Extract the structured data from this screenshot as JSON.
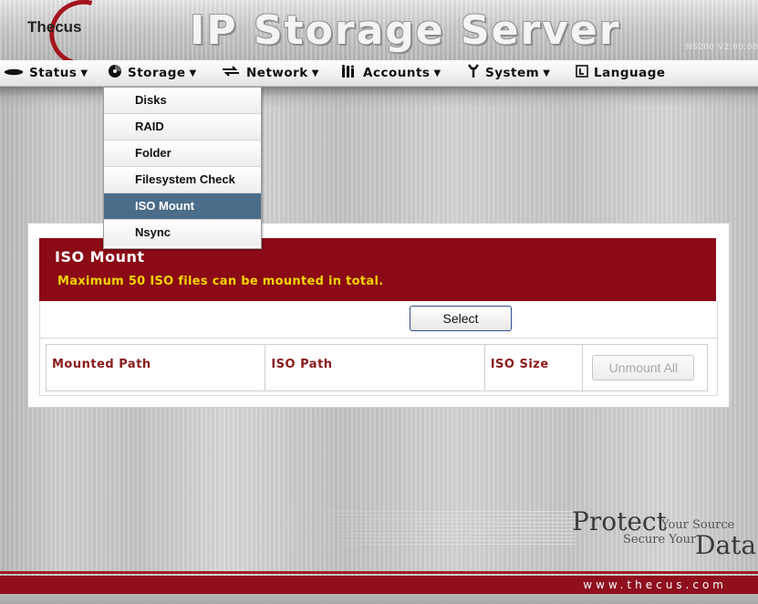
{
  "header": {
    "logo": "Thecus",
    "title": "IP Storage Server",
    "version": "N5200 V2.00.08"
  },
  "nav": {
    "items": [
      {
        "label": "Status",
        "icon": "disk-icon",
        "has_menu": true
      },
      {
        "label": "Storage",
        "icon": "storage-icon",
        "has_menu": true
      },
      {
        "label": "Network",
        "icon": "network-icon",
        "has_menu": true
      },
      {
        "label": "Accounts",
        "icon": "accounts-icon",
        "has_menu": true
      },
      {
        "label": "System",
        "icon": "wrench-icon",
        "has_menu": true
      },
      {
        "label": "Language",
        "icon": "language-icon",
        "has_menu": false
      }
    ]
  },
  "storage_menu": {
    "items": [
      "Disks",
      "RAID",
      "Folder",
      "Filesystem Check",
      "ISO Mount",
      "Nsync"
    ],
    "active": "ISO Mount"
  },
  "panel": {
    "title": "ISO Mount",
    "subtitle": "Maximum 50 ISO files can be mounted in total.",
    "select_label": "Select",
    "columns": [
      "Mounted Path",
      "ISO Path",
      "ISO Size"
    ],
    "unmount_all_label": "Unmount All"
  },
  "tagline": {
    "word1": "Protect",
    "phrase1": "Your Source",
    "phrase2": "Secure Your",
    "word2": "Data"
  },
  "footer": {
    "url": "www.thecus.com"
  },
  "colors": {
    "brand_red": "#8a0a16",
    "menu_active": "#4b6d8a",
    "notice_yellow": "#f3d400"
  }
}
